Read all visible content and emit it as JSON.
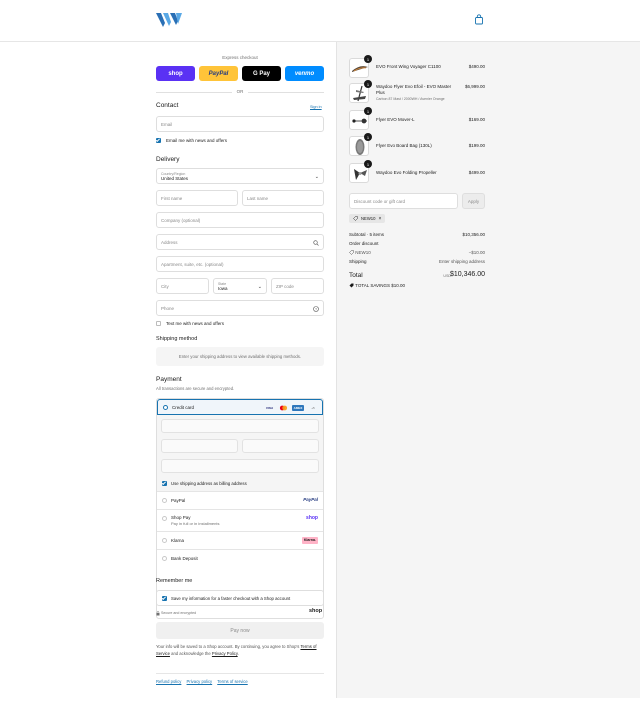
{
  "header": {
    "logo": "w-logo",
    "cart_icon": "bag-icon"
  },
  "express": {
    "title": "Express checkout",
    "buttons": [
      {
        "label": "shop",
        "bg": "#5a31f4",
        "fg": "#ffffff"
      },
      {
        "label": "PayPal",
        "bg": "#ffc439",
        "fg": "#253b80"
      },
      {
        "label": "G Pay",
        "bg": "#000000",
        "fg": "#ffffff"
      },
      {
        "label": "venmo",
        "bg": "#008cff",
        "fg": "#ffffff"
      }
    ],
    "or": "OR"
  },
  "contact": {
    "title": "Contact",
    "sign_in": "Sign in",
    "email_placeholder": "Email",
    "news_label": "Email me with news and offers"
  },
  "delivery": {
    "title": "Delivery",
    "country_label": "Country/Region",
    "country_value": "United States",
    "first_name": "First name",
    "last_name": "Last name",
    "company": "Company (optional)",
    "address": "Address",
    "apartment": "Apartment, suite, etc. (optional)",
    "city": "City",
    "state_label": "State",
    "state_value": "Iowa",
    "zip": "ZIP code",
    "phone": "Phone",
    "text_label": "Text me with news and offers"
  },
  "shipping": {
    "title": "Shipping method",
    "message": "Enter your shipping address to view available shipping methods."
  },
  "payment": {
    "title": "Payment",
    "subtitle": "All transactions are secure and encrypted.",
    "credit_card": "Credit card",
    "card_logos": [
      {
        "label": "VISA",
        "bg": "#ffffff",
        "fg": "#1a1f71"
      },
      {
        "label": "MC",
        "bg": "#ffffff",
        "fg": "#eb001b"
      },
      {
        "label": "AMEX",
        "bg": "#2e77bc",
        "fg": "#ffffff"
      },
      {
        "label": "+5",
        "bg": "#ffffff",
        "fg": "#707070"
      }
    ],
    "billing_label": "Use shipping address as billing address",
    "options": [
      {
        "label": "PayPal",
        "sub": "",
        "badge": "PayPal",
        "badge_color": "#253b80"
      },
      {
        "label": "Shop Pay",
        "sub": "Pay in full or in installments",
        "badge": "shop",
        "badge_color": "#5a31f4"
      },
      {
        "label": "Klarna",
        "sub": "",
        "badge": "Klarna.",
        "badge_color": "#ffb3c7"
      },
      {
        "label": "Bank Deposit",
        "sub": "",
        "badge": "",
        "badge_color": ""
      }
    ]
  },
  "remember": {
    "title": "Remember me",
    "save_label": "Save my information for a faster checkout with a Shop account",
    "secure_label": "Secure and encrypted",
    "shop_logo": "shop"
  },
  "pay_now": "Pay now",
  "legal": {
    "text1": "Your info will be saved to a Shop account. By continuing, you agree to Shop's",
    "terms": "Terms of Service",
    "and": "and acknowledge the",
    "privacy": "Privacy Policy",
    "dot": "."
  },
  "footer_links": [
    "Refund policy",
    "Privacy policy",
    "Terms of service"
  ],
  "order": {
    "items": [
      {
        "name": "EVO Front Wing Voyager C1100",
        "sub": "",
        "price": "$490.00",
        "qty": "1"
      },
      {
        "name": "Waydoo Flyer Evo Efoil - EVO Master Plus",
        "sub": "Carbon 87 Mast / 2000WH / Avenier Orange",
        "price": "$6,999.00",
        "qty": "1"
      },
      {
        "name": "Flyer EVO Mover-L",
        "sub": "",
        "price": "$169.00",
        "qty": "1"
      },
      {
        "name": "Flyer Evo Board Bag (130L)",
        "sub": "",
        "price": "$199.00",
        "qty": "1"
      },
      {
        "name": "Waydoo Evo Folding Propeller",
        "sub": "",
        "price": "$499.00",
        "qty": "1"
      }
    ],
    "discount_placeholder": "Discount code or gift card",
    "apply": "Apply",
    "code_chip": "NEW10",
    "subtotal_label": "Subtotal · 5 items",
    "subtotal_value": "$10,356.00",
    "order_discount_label": "Order discount",
    "code_label": "NEW10",
    "code_value": "−$10.00",
    "shipping_label": "Shipping",
    "shipping_value": "Enter shipping address",
    "total_label": "Total",
    "currency": "USD",
    "total_value": "$10,346.00",
    "savings_label": "TOTAL SAVINGS",
    "savings_value": "$10.00"
  },
  "colors": {
    "accent": "#1773b0",
    "logo_a": "#2a6fb5",
    "logo_b": "#5aa9e6"
  }
}
